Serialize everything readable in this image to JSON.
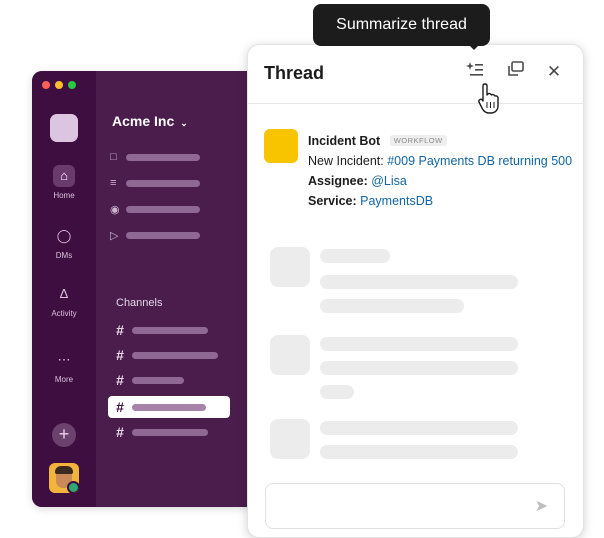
{
  "workspace": {
    "name": "Acme Inc",
    "chevron_icon": "chevron-down-icon"
  },
  "rail": {
    "items": [
      {
        "label": "Home",
        "icon": "home-icon"
      },
      {
        "label": "DMs",
        "icon": "dms-icon"
      },
      {
        "label": "Activity",
        "icon": "bell-icon"
      },
      {
        "label": "More",
        "icon": "more-icon"
      }
    ],
    "add_label": "+"
  },
  "sidebar": {
    "nav_icons": [
      "threads-icon",
      "list-icon",
      "mention-icon",
      "send-icon"
    ],
    "channels_heading": "Channels",
    "channel_hash": "#"
  },
  "tooltip": {
    "text": "Summarize thread"
  },
  "thread": {
    "title": "Thread",
    "header_icons": [
      "summarize-icon",
      "open-window-icon",
      "close-icon"
    ],
    "message": {
      "sender": "Incident Bot",
      "tag": "WORKFLOW",
      "line1_label": "New Incident:",
      "line1_link": "#009 Payments DB returning 500",
      "assignee_label": "Assignee:",
      "assignee_value": "@Lisa",
      "service_label": "Service:",
      "service_value": "PaymentsDB"
    }
  },
  "colors": {
    "sidebar": "#4a1d4c",
    "rail": "#3f0e40",
    "link": "#1264a3",
    "bot_avatar": "#f8c400",
    "traffic_red": "#ff5f57",
    "traffic_yellow": "#febc2e",
    "traffic_green": "#28c840"
  }
}
